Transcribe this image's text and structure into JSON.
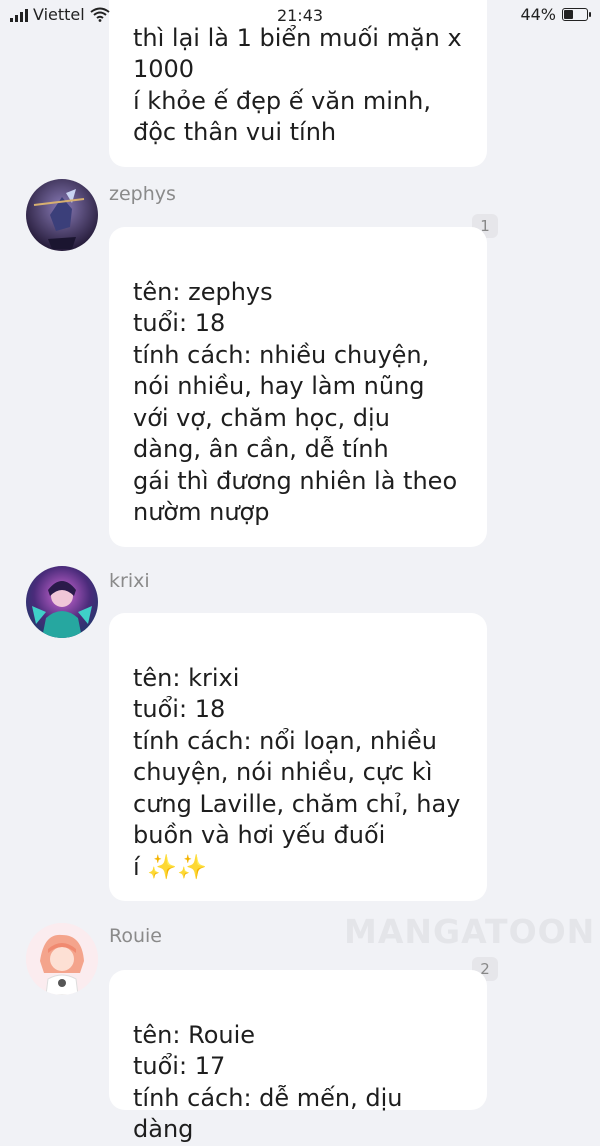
{
  "status_bar": {
    "carrier": "Viettel",
    "time": "21:43",
    "battery": "44%",
    "battery_level": 0.44
  },
  "messages": [
    {
      "text": "thì lại là 1 biển muối mặn x\n1000\ní khỏe ế đẹp ế văn minh,\nđộc thân vui tính"
    },
    {
      "username": "zephys",
      "badge": "1",
      "text": "tên: zephys\ntuổi: 18\ntính cách: nhiều chuyện, nói nhiều, hay làm nũng với vợ, chăm học, dịu dàng, ân cần, dễ tính\ngái thì đương nhiên là theo nườm nượp"
    },
    {
      "username": "krixi",
      "text": "tên: krixi\ntuổi: 18\ntính cách: nổi loạn, nhiều chuyện, nói nhiều, cực kì cưng Laville, chăm chỉ, hay buồn và hơi yếu đuối\ní ",
      "emoji": "✨✨"
    },
    {
      "username": "Rouie",
      "badge": "2",
      "text": "tên: Rouie\ntuổi: 17\ntính cách: dễ mến, dịu dàng"
    }
  ],
  "watermark": "MANGATOON",
  "colors": {
    "background": "#f1f2f6",
    "bubble": "#ffffff",
    "username": "#8a8a8a"
  }
}
